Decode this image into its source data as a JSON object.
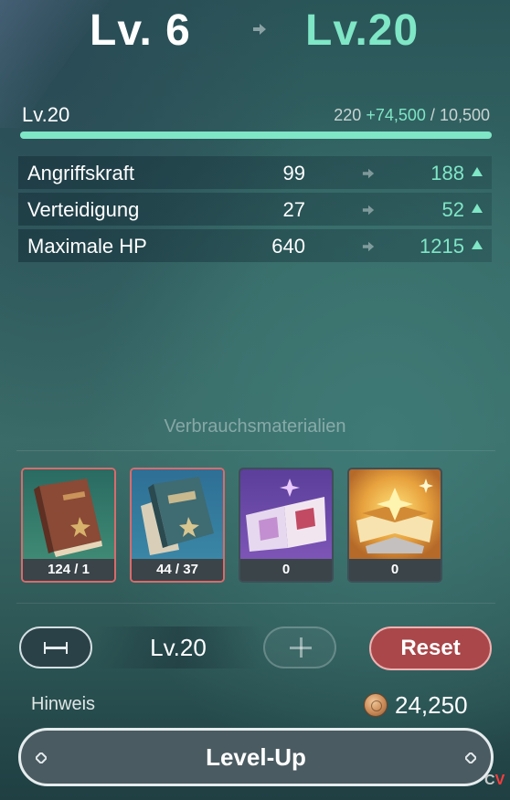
{
  "header": {
    "level_from": "Lv. 6",
    "level_to": "Lv.20"
  },
  "exp": {
    "level_label": "Lv.20",
    "current": "220",
    "gain": "+74,500",
    "separator": " / ",
    "max": "10,500",
    "progress": 1.0
  },
  "stats": [
    {
      "name": "Angriffskraft",
      "current": "99",
      "next": "188"
    },
    {
      "name": "Verteidigung",
      "current": "27",
      "next": "52"
    },
    {
      "name": "Maximale HP",
      "current": "640",
      "next": "1215"
    }
  ],
  "materials": {
    "title": "Verbrauchsmaterialien",
    "items": [
      {
        "count": "124 / 1",
        "icon": "brown-book-icon",
        "selected": true
      },
      {
        "count": "44 / 37",
        "icon": "blue-book-icon",
        "selected": true
      },
      {
        "count": "0",
        "icon": "purple-book-icon",
        "selected": false
      },
      {
        "count": "0",
        "icon": "gold-book-icon",
        "selected": false
      }
    ]
  },
  "level_select": {
    "value": "Lv.20",
    "minus_icon": "minus-icon",
    "plus_icon": "plus-icon"
  },
  "reset_label": "Reset",
  "hint_label": "Hinweis",
  "cost": {
    "icon": "mora-coin-icon",
    "value": "24,250"
  },
  "levelup_label": "Level-Up",
  "watermark": {
    "c": "C",
    "v": "V"
  },
  "colors": {
    "accent": "#7fe6c6",
    "reset": "#a9474a",
    "selected_border": "#d96b6b"
  }
}
